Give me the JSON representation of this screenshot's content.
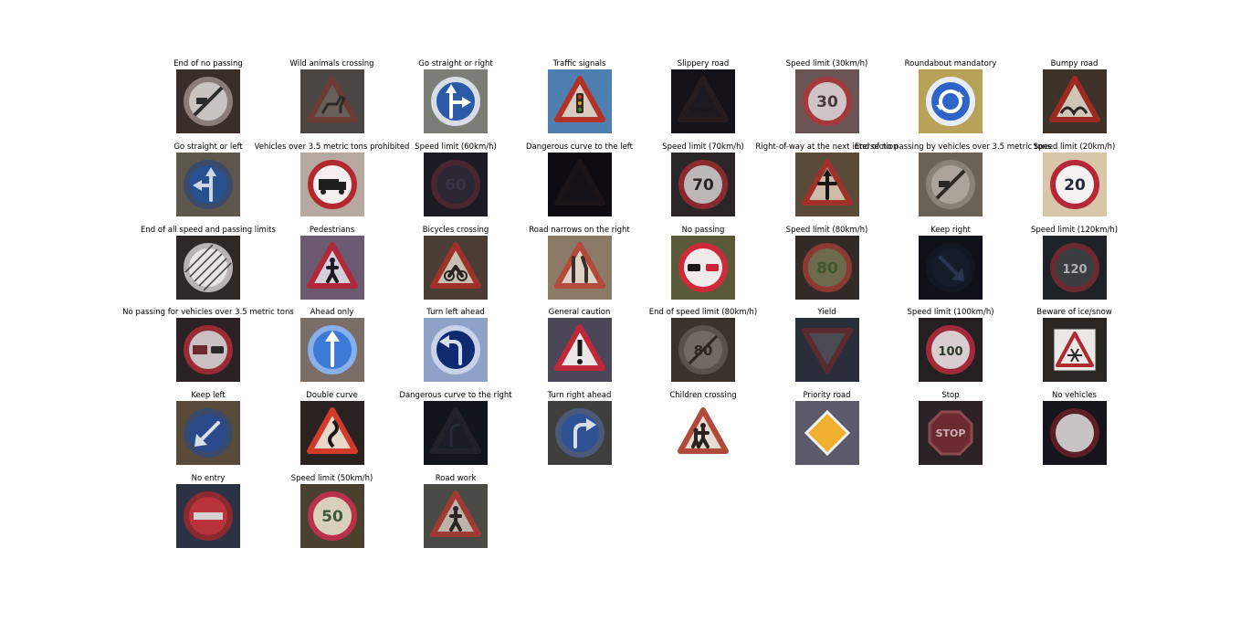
{
  "figure": {
    "cells": [
      {
        "title": "End of no passing",
        "bg": "#3a2e2a",
        "sign": {
          "shape": "circle",
          "fill": "#c9c4c0",
          "stroke": "#8a7d77",
          "glyph": "diag-stripe-arrow",
          "glyph_color": "#2c2c2c"
        }
      },
      {
        "title": "Wild animals crossing",
        "bg": "#4a4644",
        "sign": {
          "shape": "triangle",
          "fill": "#6a605a",
          "stroke": "#6d3a34",
          "glyph": "deer",
          "glyph_color": "#2e2a28"
        }
      },
      {
        "title": "Go straight or right",
        "bg": "#7a7e76",
        "sign": {
          "shape": "circle",
          "fill": "#2a5aa8",
          "stroke": "#d8dce4",
          "glyph": "arrow-up-right",
          "glyph_color": "#ffffff"
        }
      },
      {
        "title": "Traffic signals",
        "bg": "#4d7fb0",
        "sign": {
          "shape": "triangle",
          "fill": "#d8ccc0",
          "stroke": "#b33228",
          "glyph": "traffic-light",
          "glyph_color": "#3a2a20"
        }
      },
      {
        "title": "Slippery road",
        "bg": "#141218",
        "sign": {
          "shape": "triangle",
          "fill": "#1c1a20",
          "stroke": "#261c1e",
          "glyph": "car-skid",
          "glyph_color": "#18161a"
        }
      },
      {
        "title": "Speed limit (30km/h)",
        "bg": "#6a5455",
        "sign": {
          "shape": "circle",
          "fill": "#cfc4c6",
          "stroke": "#a23a3e",
          "glyph": "30",
          "glyph_color": "#4a3a3a"
        }
      },
      {
        "title": "Roundabout mandatory",
        "bg": "#b8a25a",
        "sign": {
          "shape": "circle",
          "fill": "#2e64c8",
          "stroke": "#e8eef8",
          "glyph": "roundabout",
          "glyph_color": "#ffffff"
        }
      },
      {
        "title": "Bumpy road",
        "bg": "#3c3228",
        "sign": {
          "shape": "triangle",
          "fill": "#cfc6b8",
          "stroke": "#9c2a22",
          "glyph": "bumps",
          "glyph_color": "#2a2420"
        }
      },
      {
        "title": "Go straight or left",
        "bg": "#5e574e",
        "sign": {
          "shape": "circle",
          "fill": "#27508e",
          "stroke": "#3a4a68",
          "glyph": "arrow-up-left",
          "glyph_color": "#cfd6e4"
        }
      },
      {
        "title": "Vehicles over 3.5 metric tons prohibited",
        "bg": "#b8a8a2",
        "sign": {
          "shape": "circle",
          "fill": "#f2efee",
          "stroke": "#b3282e",
          "glyph": "truck",
          "glyph_color": "#1e1e1e"
        }
      },
      {
        "title": "Speed limit (60km/h)",
        "bg": "#1c1a22",
        "sign": {
          "shape": "circle",
          "fill": "#2a2632",
          "stroke": "#4a2630",
          "glyph": "60",
          "glyph_color": "#3a3446"
        }
      },
      {
        "title": "Dangerous curve to the left",
        "bg": "#0e0c10",
        "sign": {
          "shape": "triangle",
          "fill": "#141216",
          "stroke": "#1a1416",
          "glyph": "none",
          "glyph_color": "#141216"
        }
      },
      {
        "title": "Speed limit (70km/h)",
        "bg": "#2a2628",
        "sign": {
          "shape": "circle",
          "fill": "#bdb7b8",
          "stroke": "#8a2a30",
          "glyph": "70",
          "glyph_color": "#2a2424"
        }
      },
      {
        "title": "Right-of-way at the next intersection",
        "bg": "#5a4a38",
        "sign": {
          "shape": "triangle",
          "fill": "#cdbca8",
          "stroke": "#a0302a",
          "glyph": "cross-arrow",
          "glyph_color": "#1a1614"
        }
      },
      {
        "title": "End of no passing by vehicles over 3.5 metric tons",
        "bg": "#6a6256",
        "sign": {
          "shape": "circle",
          "fill": "#aca49a",
          "stroke": "#8a8276",
          "glyph": "diag-stripe-arrow",
          "glyph_color": "#2a2622"
        }
      },
      {
        "title": "Speed limit (20km/h)",
        "bg": "#d8c6a8",
        "sign": {
          "shape": "circle",
          "fill": "#f4f2f0",
          "stroke": "#b5283a",
          "glyph": "20",
          "glyph_color": "#1e2a3a"
        }
      },
      {
        "title": "End of all speed and passing limits",
        "bg": "#2e2826",
        "sign": {
          "shape": "circle",
          "fill": "#e8e6e4",
          "stroke": "#b8b4b2",
          "glyph": "diag-stripes",
          "glyph_color": "#3a3a3a"
        }
      },
      {
        "title": "Pedestrians",
        "bg": "#6c5a72",
        "sign": {
          "shape": "triangle",
          "fill": "#d6d0da",
          "stroke": "#b0283a",
          "glyph": "pedestrian",
          "glyph_color": "#1e1a22"
        }
      },
      {
        "title": "Bicycles crossing",
        "bg": "#4a3e34",
        "sign": {
          "shape": "triangle",
          "fill": "#c8c0b2",
          "stroke": "#a0302a",
          "glyph": "bicycle",
          "glyph_color": "#2a2420"
        }
      },
      {
        "title": "Road narrows on the right",
        "bg": "#8a7a66",
        "sign": {
          "shape": "triangle",
          "fill": "#ddd2c4",
          "stroke": "#b4483a",
          "glyph": "narrows",
          "glyph_color": "#3a302a"
        }
      },
      {
        "title": "No passing",
        "bg": "#5a5a3a",
        "sign": {
          "shape": "circle",
          "fill": "#f0eaea",
          "stroke": "#cf2a3c",
          "glyph": "two-cars",
          "glyph_color": "#1a1a1a"
        }
      },
      {
        "title": "Speed limit (80km/h)",
        "bg": "#322a26",
        "sign": {
          "shape": "circle",
          "fill": "#6e6a4e",
          "stroke": "#8a3a30",
          "glyph": "80",
          "glyph_color": "#3a5a2a"
        }
      },
      {
        "title": "Keep right",
        "bg": "#0e1218",
        "sign": {
          "shape": "circle",
          "fill": "#141c2a",
          "stroke": "#121822",
          "glyph": "arrow-down-right",
          "glyph_color": "#2a3650"
        }
      },
      {
        "title": "Speed limit (120km/h)",
        "bg": "#1e2226",
        "sign": {
          "shape": "circle",
          "fill": "#3a3e42",
          "stroke": "#6a2a30",
          "glyph": "120",
          "glyph_color": "#aeb2b4"
        }
      },
      {
        "title": "No passing for vehicles over 3.5 metric tons",
        "bg": "#2a2224",
        "sign": {
          "shape": "circle",
          "fill": "#c8c0c2",
          "stroke": "#9a2a34",
          "glyph": "truck-car",
          "glyph_color": "#6a2a30"
        }
      },
      {
        "title": "Ahead only",
        "bg": "#7a6e66",
        "sign": {
          "shape": "circle",
          "fill": "#3c7ad8",
          "stroke": "#8ab0ea",
          "glyph": "arrow-up",
          "glyph_color": "#ffffff"
        }
      },
      {
        "title": "Turn left ahead",
        "bg": "#8ea2c8",
        "sign": {
          "shape": "circle",
          "fill": "#0e2a70",
          "stroke": "#c8d2e8",
          "glyph": "turn-left",
          "glyph_color": "#d8e0f0"
        }
      },
      {
        "title": "General caution",
        "bg": "#4a4658",
        "sign": {
          "shape": "triangle",
          "fill": "#ece8ea",
          "stroke": "#c0283a",
          "glyph": "exclaim",
          "glyph_color": "#1a1a1a"
        }
      },
      {
        "title": "End of speed limit (80km/h)",
        "bg": "#3a322c",
        "sign": {
          "shape": "circle",
          "fill": "#726a62",
          "stroke": "#5a524a",
          "glyph": "80-struck",
          "glyph_color": "#2a2420"
        }
      },
      {
        "title": "Yield",
        "bg": "#2a2e3a",
        "sign": {
          "shape": "inv-triangle",
          "fill": "#4a4a52",
          "stroke": "#5a2a2e",
          "glyph": "none",
          "glyph_color": "#4a4a52"
        }
      },
      {
        "title": "Speed limit (100km/h)",
        "bg": "#242022",
        "sign": {
          "shape": "circle",
          "fill": "#d8cdd0",
          "stroke": "#a02a3a",
          "glyph": "100",
          "glyph_color": "#2a3a2a"
        }
      },
      {
        "title": "Beware of ice/snow",
        "bg": "#2a2624",
        "sign": {
          "shape": "triangle-on-square",
          "fill": "#ece8e6",
          "stroke": "#b02830",
          "glyph": "snowflake",
          "glyph_color": "#2a2a2a"
        }
      },
      {
        "title": "Keep left",
        "bg": "#5a4a3a",
        "sign": {
          "shape": "circle",
          "fill": "#2a4a8a",
          "stroke": "#3a4a6a",
          "glyph": "arrow-down-left",
          "glyph_color": "#d8dee8"
        }
      },
      {
        "title": "Double curve",
        "bg": "#2a2220",
        "sign": {
          "shape": "triangle",
          "fill": "#e8d8cc",
          "stroke": "#d23a2a",
          "glyph": "double-curve",
          "glyph_color": "#1a1614"
        }
      },
      {
        "title": "Dangerous curve to the right",
        "bg": "#12141c",
        "sign": {
          "shape": "triangle",
          "fill": "#1a1c26",
          "stroke": "#22202a",
          "glyph": "curve-right",
          "glyph_color": "#2a2a3a"
        }
      },
      {
        "title": "Turn right ahead",
        "bg": "#3e3e3c",
        "sign": {
          "shape": "circle",
          "fill": "#2e5294",
          "stroke": "#4a5a78",
          "glyph": "turn-right",
          "glyph_color": "#d6dce8"
        }
      },
      {
        "title": "Children crossing",
        "bg": "#ffffff",
        "sign": {
          "shape": "triangle",
          "fill": "#e6dcd2",
          "stroke": "#b04a3a",
          "glyph": "children",
          "glyph_color": "#2a2420"
        }
      },
      {
        "title": "Priority road",
        "bg": "#5a5a6a",
        "sign": {
          "shape": "diamond",
          "fill": "#f0b030",
          "stroke": "#f0f0f0",
          "glyph": "none",
          "glyph_color": "#f0b030"
        }
      },
      {
        "title": "Stop",
        "bg": "#2a2224",
        "sign": {
          "shape": "octagon",
          "fill": "#6a2a30",
          "stroke": "#8a4a50",
          "glyph": "STOP",
          "glyph_color": "#c8b0b4"
        }
      },
      {
        "title": "No vehicles",
        "bg": "#14141a",
        "sign": {
          "shape": "circle",
          "fill": "#c8c4c6",
          "stroke": "#5a1e24",
          "glyph": "none",
          "glyph_color": "#c8c4c6"
        }
      },
      {
        "title": "No entry",
        "bg": "#2a3244",
        "sign": {
          "shape": "circle",
          "fill": "#b8343a",
          "stroke": "#8a2a30",
          "glyph": "bar",
          "glyph_color": "#d8d0d0"
        }
      },
      {
        "title": "Speed limit (50km/h)",
        "bg": "#4a4030",
        "sign": {
          "shape": "circle",
          "fill": "#d8d0b8",
          "stroke": "#b8304a",
          "glyph": "50",
          "glyph_color": "#3a5a3a"
        }
      },
      {
        "title": "Road work",
        "bg": "#4a4a44",
        "sign": {
          "shape": "triangle",
          "fill": "#bcb4aa",
          "stroke": "#a03a32",
          "glyph": "worker",
          "glyph_color": "#2a2420"
        }
      }
    ]
  }
}
